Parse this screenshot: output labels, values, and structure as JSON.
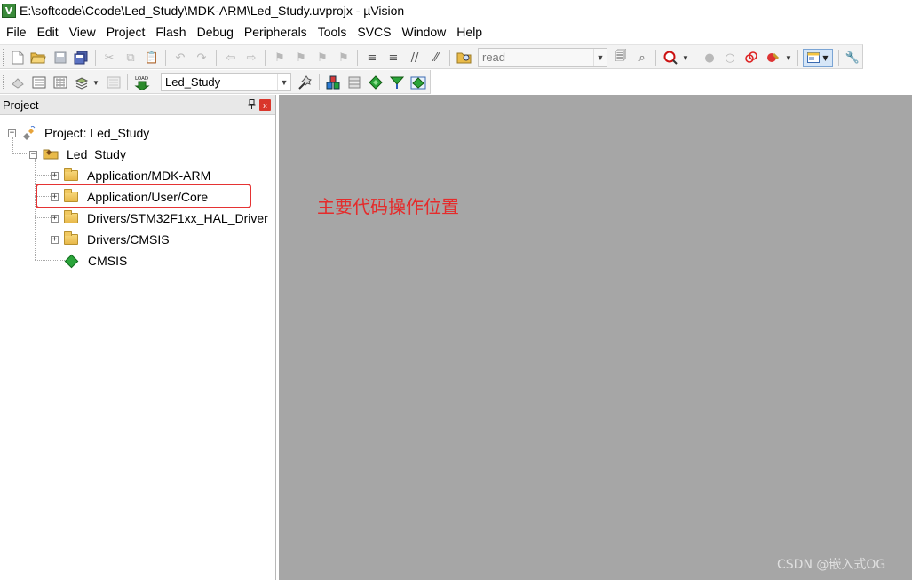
{
  "window": {
    "title": "E:\\softcode\\Ccode\\Led_Study\\MDK-ARM\\Led_Study.uvprojx - µVision",
    "app_icon": "V"
  },
  "menu": [
    "File",
    "Edit",
    "View",
    "Project",
    "Flash",
    "Debug",
    "Peripherals",
    "Tools",
    "SVCS",
    "Window",
    "Help"
  ],
  "toolbar": {
    "find_value": "read",
    "target_value": "Led_Study",
    "load_label": "LOAD"
  },
  "project_panel": {
    "title": "Project",
    "pin_glyph": "ᵖ",
    "close_glyph": "x",
    "tree": {
      "root": "Project: Led_Study",
      "target": "Led_Study",
      "groups": [
        "Application/MDK-ARM",
        "Application/User/Core",
        "Drivers/STM32F1xx_HAL_Driver",
        "Drivers/CMSIS"
      ],
      "component": "CMSIS"
    }
  },
  "annotation": "主要代码操作位置",
  "watermark": "CSDN @嵌入式OG",
  "colors": {
    "highlight": "#e53333",
    "annotation": "#e52b2b",
    "editor_background": "#a6a6a6"
  }
}
